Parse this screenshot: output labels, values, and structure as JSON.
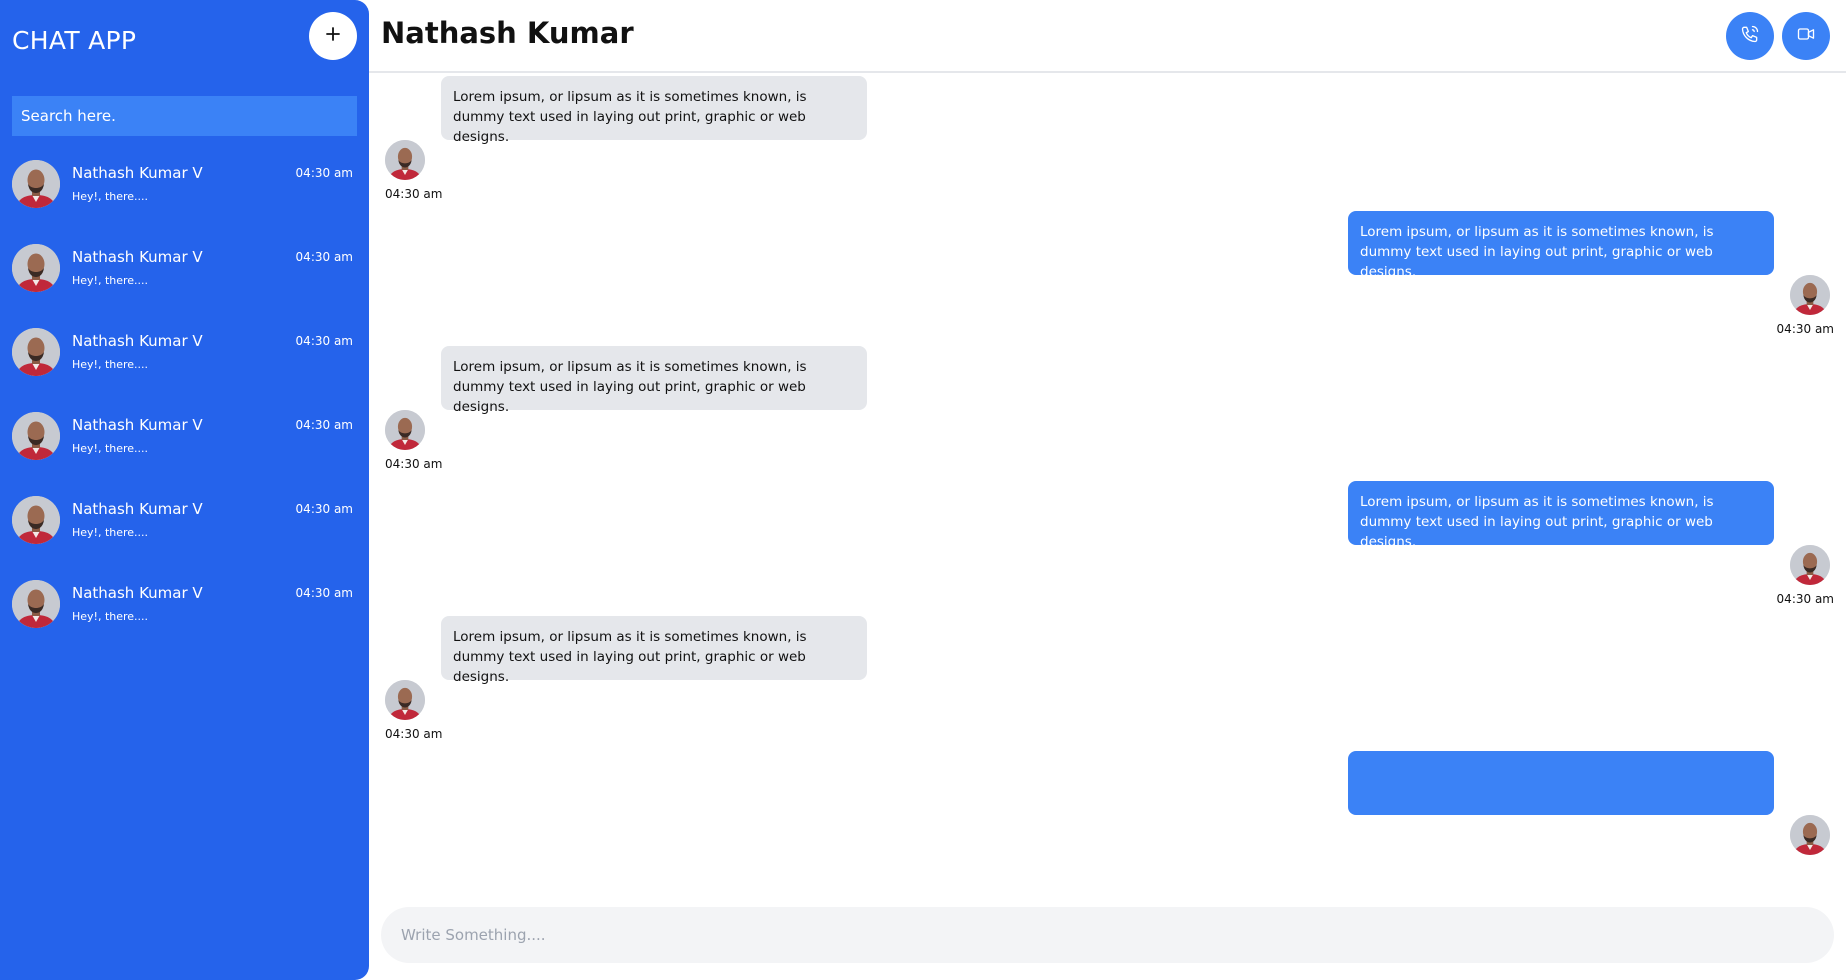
{
  "sidebar": {
    "brand": "CHAT APP",
    "add_icon": "plus-icon",
    "search_placeholder": "Search here.",
    "contacts": [
      {
        "name": "Nathash Kumar V",
        "time": "04:30 am",
        "preview": "Hey!, there...."
      },
      {
        "name": "Nathash Kumar V",
        "time": "04:30 am",
        "preview": "Hey!, there...."
      },
      {
        "name": "Nathash Kumar V",
        "time": "04:30 am",
        "preview": "Hey!, there...."
      },
      {
        "name": "Nathash Kumar V",
        "time": "04:30 am",
        "preview": "Hey!, there...."
      },
      {
        "name": "Nathash Kumar V",
        "time": "04:30 am",
        "preview": "Hey!, there...."
      },
      {
        "name": "Nathash Kumar V",
        "time": "04:30 am",
        "preview": "Hey!, there...."
      }
    ]
  },
  "chat": {
    "title": "Nathash Kumar",
    "call_icon": "phone-icon",
    "video_icon": "video-camera-icon",
    "messages": [
      {
        "direction": "incoming",
        "text": "Lorem ipsum, or lipsum as it is sometimes known, is dummy text used in laying out print, graphic or web designs.",
        "time": "04:30 am"
      },
      {
        "direction": "outgoing",
        "text": "Lorem ipsum, or lipsum as it is sometimes known, is dummy text used in laying out print, graphic or web designs.",
        "time": "04:30 am"
      },
      {
        "direction": "incoming",
        "text": "Lorem ipsum, or lipsum as it is sometimes known, is dummy text used in laying out print, graphic or web designs.",
        "time": "04:30 am"
      },
      {
        "direction": "outgoing",
        "text": "Lorem ipsum, or lipsum as it is sometimes known, is dummy text used in laying out print, graphic or web designs.",
        "time": "04:30 am"
      },
      {
        "direction": "incoming",
        "text": "Lorem ipsum, or lipsum as it is sometimes known, is dummy text used in laying out print, graphic or web designs.",
        "time": "04:30 am"
      },
      {
        "direction": "outgoing",
        "text": "",
        "time": ""
      }
    ],
    "composer_placeholder": "Write Something...."
  },
  "colors": {
    "sidebar_bg": "#2563eb",
    "accent": "#3b82f6",
    "incoming_bubble": "#e5e7eb",
    "composer_bg": "#f3f4f6"
  }
}
